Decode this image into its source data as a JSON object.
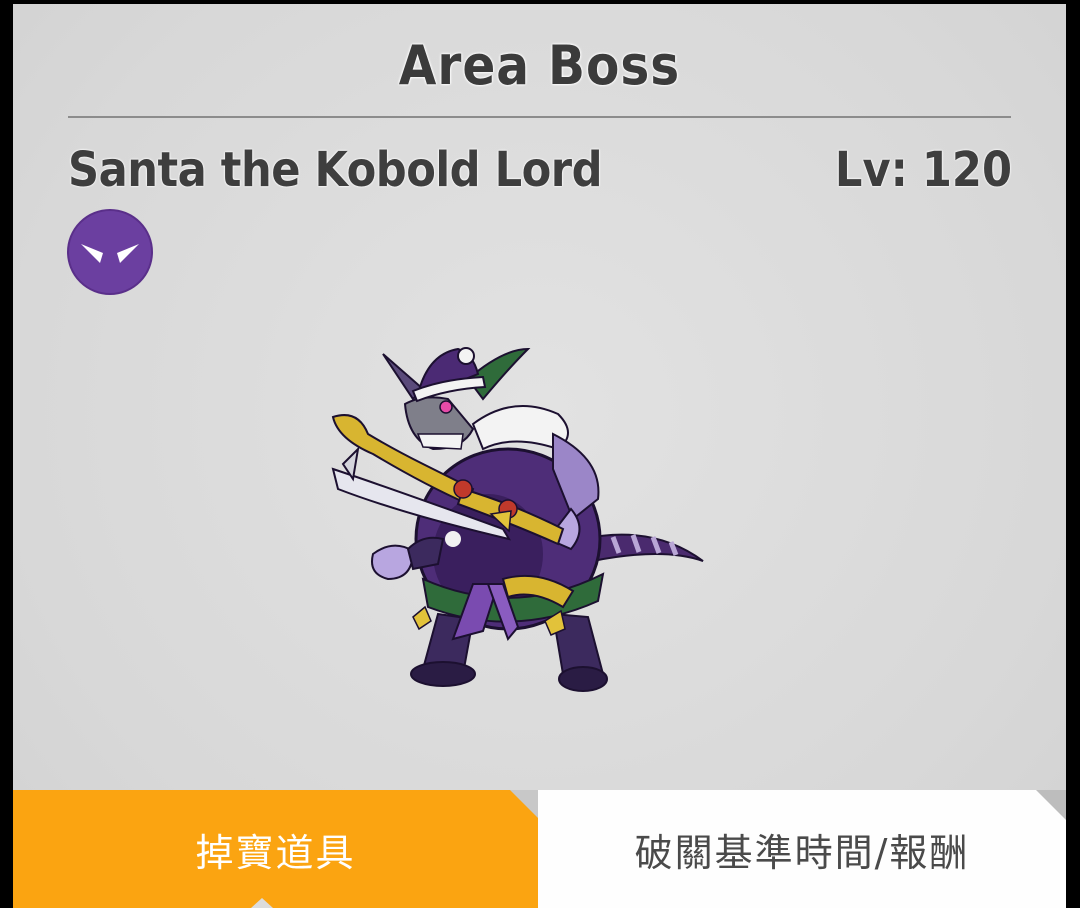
{
  "header": {
    "title": "Area Boss"
  },
  "boss": {
    "name": "Santa the Kobold Lord",
    "level_label": "Lv:",
    "level_value": "120",
    "element_icon": "dark-element-icon",
    "element_color": "#6b3fa0"
  },
  "tabs": [
    {
      "label": "掉寶道具",
      "active": true,
      "color": "#fba411"
    },
    {
      "label": "破關基準時間/報酬",
      "active": false,
      "color": "#fefefe"
    }
  ]
}
